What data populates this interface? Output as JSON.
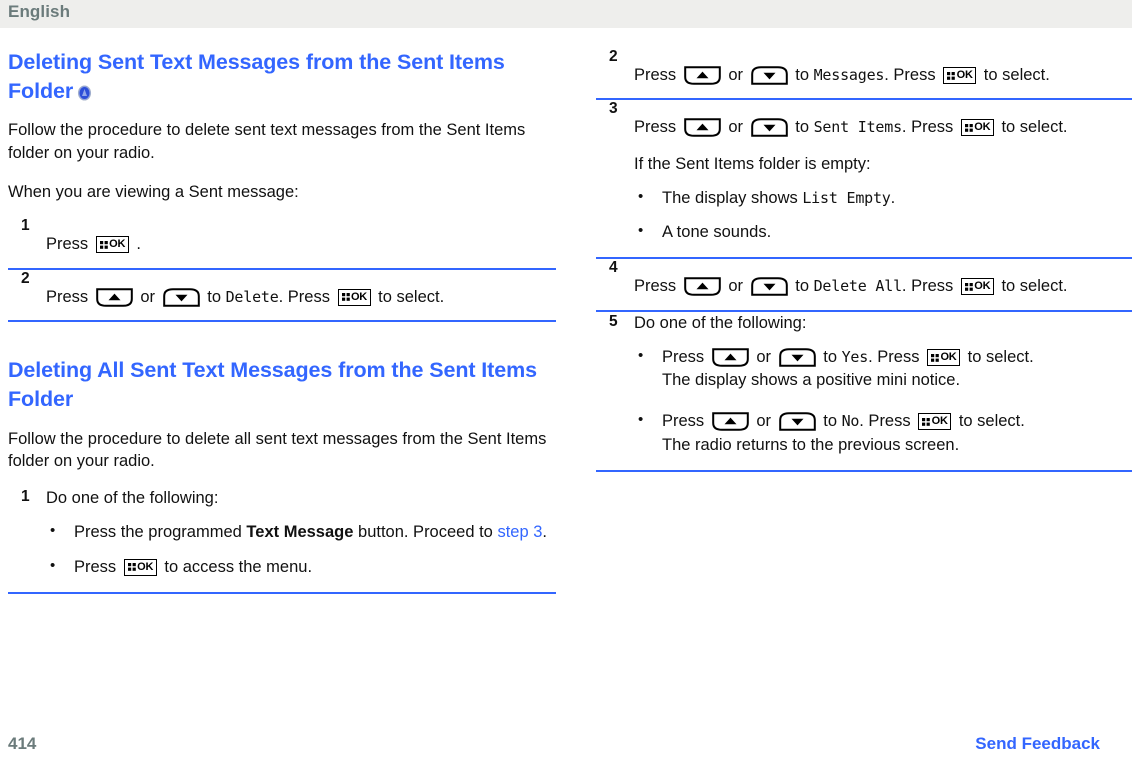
{
  "header": {
    "language": "English"
  },
  "footer": {
    "page_number": "414",
    "feedback_link": "Send Feedback",
    "page_number_color": "#6b7b7b",
    "link_color": "#3366ff"
  },
  "colors": {
    "heading": "#3366ff",
    "rule": "#3366ff",
    "body": "#111111",
    "header_band": "#eeeeec"
  },
  "left_column": {
    "section1": {
      "title": "Deleting Sent Text Messages from the Sent Items Folder",
      "title_icon": "blue-circle-badge-icon",
      "intro1": "Follow the procedure to delete sent text messages from the Sent Items folder on your radio.",
      "intro2": "When you are viewing a Sent message:",
      "steps": [
        {
          "number": "1",
          "text_before": "Press",
          "text_after": "."
        },
        {
          "number": "2",
          "text_1": "Press",
          "text_2": "or",
          "text_3": "to",
          "display": "Delete",
          "text_4": ". Press",
          "text_5": "to select."
        }
      ]
    },
    "section2": {
      "title": "Deleting All Sent Text Messages from the Sent Items Folder",
      "intro1": "Follow the procedure to delete all sent text messages from the Sent Items folder on your radio.",
      "steps": [
        {
          "number": "1",
          "lead": "Do one of the following:",
          "bullets": [
            {
              "text_1": "Press the programmed",
              "bold": "Text Message",
              "text_2": "button. Proceed to",
              "link": "step 3",
              "text_3": "."
            },
            {
              "text_1": "Press",
              "text_2": "to access the menu."
            }
          ]
        }
      ]
    }
  },
  "right_column": {
    "steps": [
      {
        "number": "2",
        "text_1": "Press",
        "text_2": "or",
        "text_3": "to",
        "display": "Messages",
        "text_4": ". Press",
        "text_5": "to select."
      },
      {
        "number": "3",
        "text_1": "Press",
        "text_2": "or",
        "text_3": "to",
        "display": "Sent Items",
        "text_4": ". Press",
        "text_5": "to select.",
        "note": "If the Sent Items folder is empty:",
        "bullets": [
          {
            "text_1": "The display shows",
            "display": "List Empty",
            "text_2": "."
          },
          {
            "text_1": "A tone sounds."
          }
        ]
      },
      {
        "number": "4",
        "text_1": "Press",
        "text_2": "or",
        "text_3": "to",
        "display": "Delete All",
        "text_4": ". Press",
        "text_5": "to select."
      },
      {
        "number": "5",
        "lead": "Do one of the following:",
        "bullets": [
          {
            "text_1": "Press",
            "text_2": "or",
            "text_3": "to",
            "display": "Yes",
            "text_4": ". Press",
            "text_5": "to select.",
            "extra": "The display shows a positive mini notice."
          },
          {
            "text_1": "Press",
            "text_2": "or",
            "text_3": "to",
            "display": "No",
            "text_4": ". Press",
            "text_5": "to select.",
            "extra": "The radio returns to the previous screen."
          }
        ]
      }
    ]
  },
  "icons": {
    "ok_label": "OK",
    "ok_icon_name": "menu-ok-button-icon",
    "up_icon_name": "up-arrow-button-icon",
    "down_icon_name": "down-arrow-button-icon"
  }
}
